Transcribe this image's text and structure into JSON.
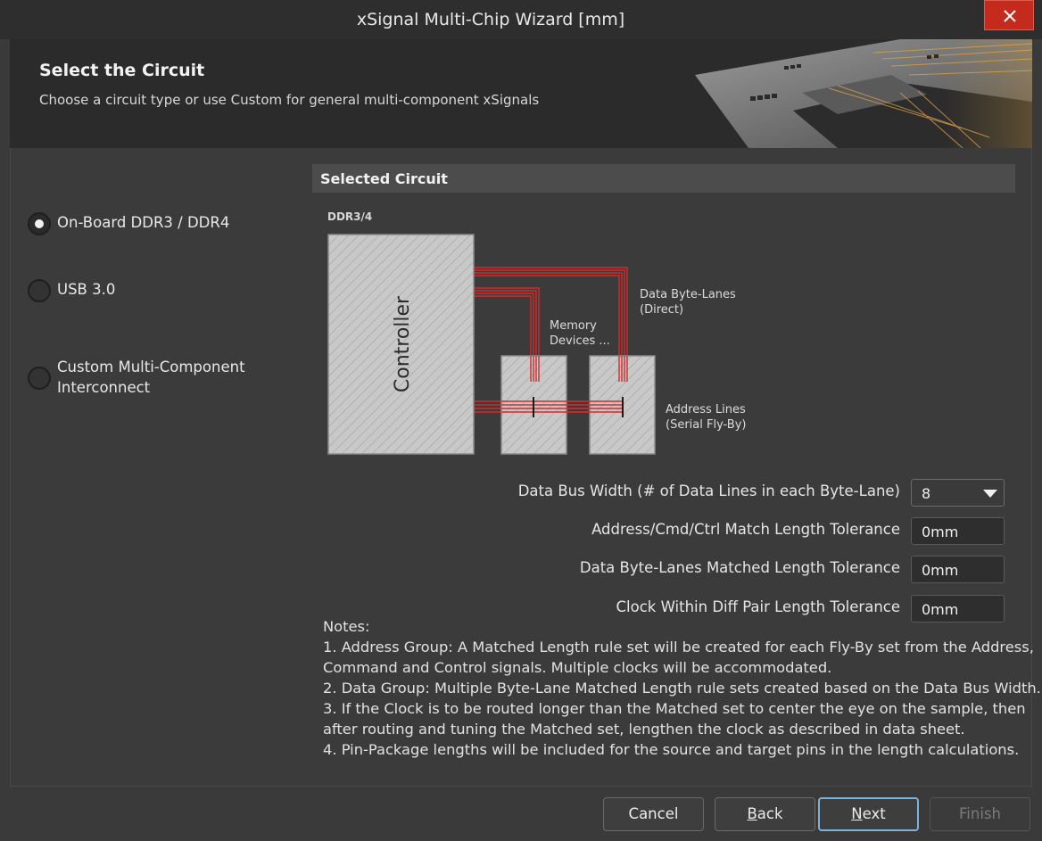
{
  "window": {
    "title": "xSignal Multi-Chip Wizard [mm]",
    "close_icon": "close-icon"
  },
  "banner": {
    "title": "Select the Circuit",
    "subtitle": "Choose a circuit type or use Custom for general multi-component xSignals"
  },
  "circuit_options": [
    {
      "label": "On-Board DDR3 / DDR4",
      "selected": true
    },
    {
      "label": "USB 3.0",
      "selected": false
    },
    {
      "label": "Custom Multi-Component Interconnect",
      "selected": false
    }
  ],
  "selected_circuit": {
    "header": "Selected Circuit",
    "diagram": {
      "title": "DDR3/4",
      "controller": "Controller",
      "memory_label_1": "Memory",
      "memory_label_2": "Devices ...",
      "data_label_1": "Data Byte-Lanes",
      "data_label_2": "(Direct)",
      "address_label_1": "Address Lines",
      "address_label_2": "(Serial Fly-By)",
      "trace_color": "#d42a2a"
    }
  },
  "fields": {
    "data_bus_width": {
      "label": "Data Bus Width (# of Data Lines in each Byte-Lane)",
      "value": "8"
    },
    "addr_tolerance": {
      "label": "Address/Cmd/Ctrl Match Length Tolerance",
      "value": "0mm"
    },
    "data_tolerance": {
      "label": "Data Byte-Lanes Matched Length Tolerance",
      "value": "0mm"
    },
    "clock_tolerance": {
      "label": "Clock Within Diff Pair Length Tolerance",
      "value": "0mm"
    }
  },
  "notes": {
    "heading": "Notes:",
    "lines": [
      "1. Address Group: A Matched Length rule set will be created for each Fly-By set from the Address,",
      "Command and Control signals. Multiple clocks will be accommodated.",
      "2. Data Group: Multiple Byte-Lane Matched Length rule sets created based on the Data Bus Width.",
      "3. If the Clock is to be routed longer than the Matched set to center the eye on the sample, then",
      "after routing and tuning the Matched set, lengthen the clock as described in data sheet.",
      "4. Pin-Package lengths will be included for the source and target pins in the length calculations."
    ]
  },
  "buttons": {
    "cancel": "Cancel",
    "back_ul": "B",
    "back_rest": "ack",
    "next_ul": "N",
    "next_rest": "ext",
    "finish": "Finish"
  },
  "colors": {
    "accent": "#7fb1dc",
    "close": "#c42b1c"
  }
}
